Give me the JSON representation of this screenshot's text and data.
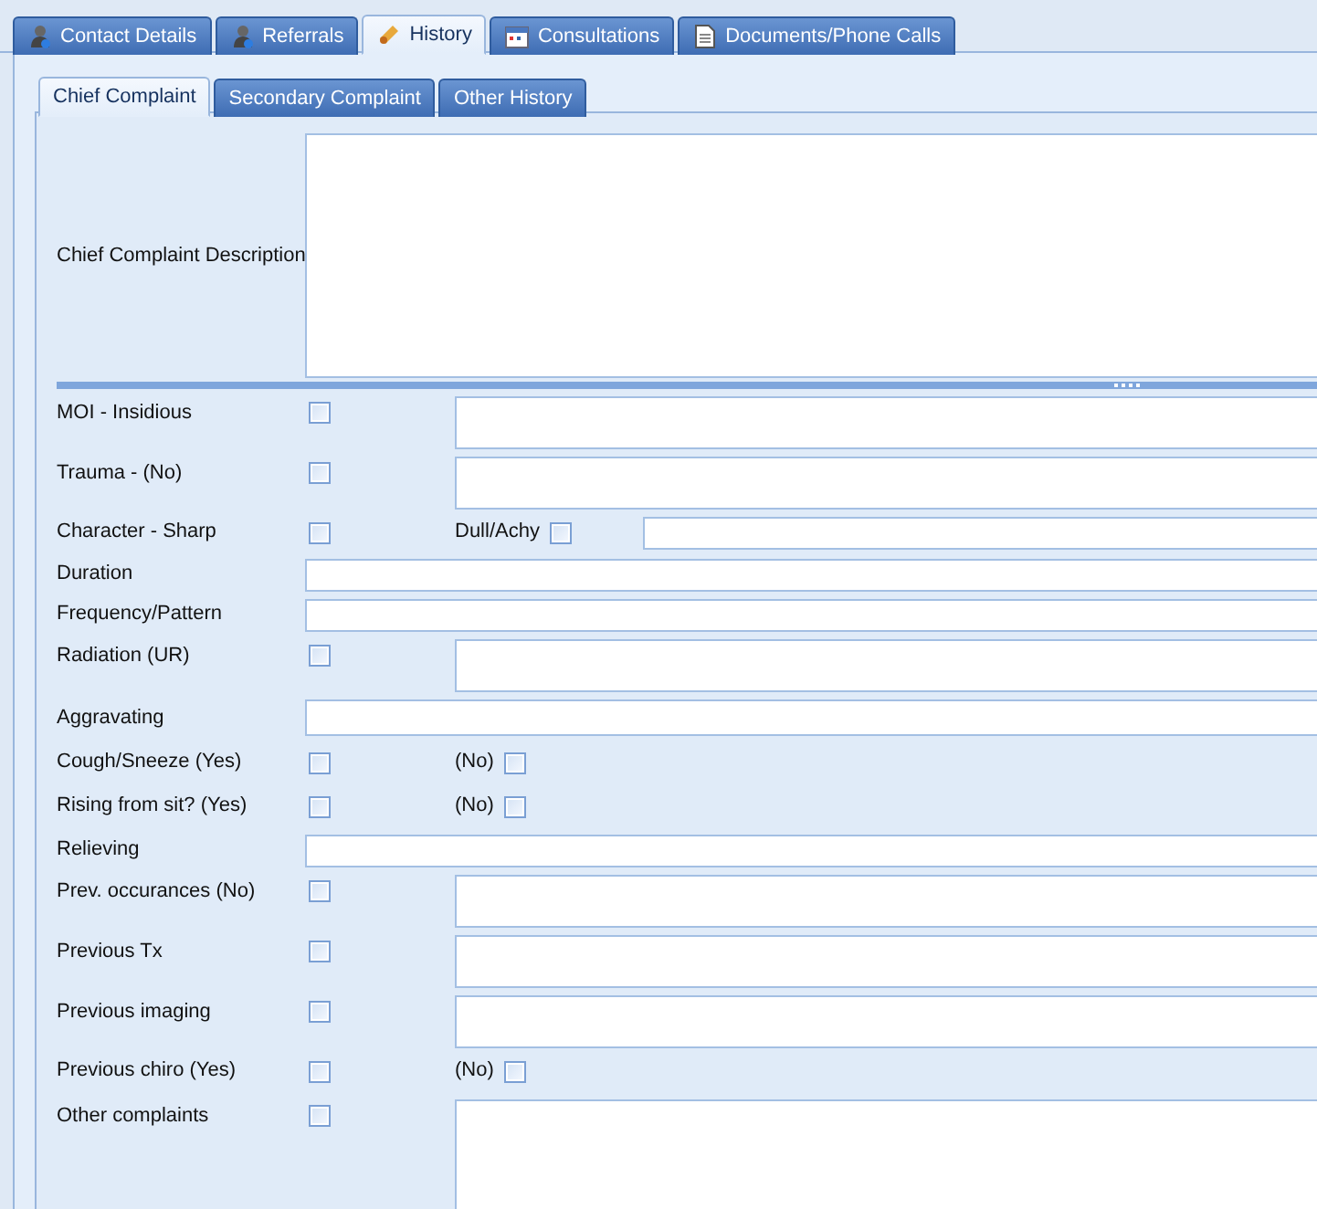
{
  "main_tabs": [
    {
      "label": "Contact Details",
      "selected": false
    },
    {
      "label": "Referrals",
      "selected": false
    },
    {
      "label": "History",
      "selected": true
    },
    {
      "label": "Consultations",
      "selected": false
    },
    {
      "label": "Documents/Phone Calls",
      "selected": false
    }
  ],
  "sub_tabs": [
    {
      "label": "Chief Complaint",
      "selected": true
    },
    {
      "label": "Secondary Complaint",
      "selected": false
    },
    {
      "label": "Other History",
      "selected": false
    }
  ],
  "description": {
    "label": "Chief Complaint Description"
  },
  "rows": [
    {
      "kind": "check_memo",
      "label": "MOI - Insidious",
      "checked": false
    },
    {
      "kind": "check_memo",
      "label": "Trauma - (No)",
      "checked": false
    },
    {
      "kind": "check_pair_field",
      "label": "Character - Sharp",
      "checked": false,
      "second_label": "Dull/Achy",
      "second_checked": false
    },
    {
      "kind": "text",
      "label": "Duration"
    },
    {
      "kind": "text",
      "label": "Frequency/Pattern"
    },
    {
      "kind": "check_memo",
      "label": "Radiation (UR)",
      "checked": false
    },
    {
      "kind": "text_tall",
      "label": "Aggravating"
    },
    {
      "kind": "check_pair",
      "label": "Cough/Sneeze (Yes)",
      "checked": false,
      "second_label": "(No)",
      "second_checked": false
    },
    {
      "kind": "check_pair",
      "label": "Rising from sit? (Yes)",
      "checked": false,
      "second_label": "(No)",
      "second_checked": false
    },
    {
      "kind": "text",
      "label": "Relieving"
    },
    {
      "kind": "check_memo",
      "label": "Prev. occurances (No)",
      "checked": false
    },
    {
      "kind": "check_memo",
      "label": "Previous Tx",
      "checked": false
    },
    {
      "kind": "check_memo",
      "label": "Previous imaging",
      "checked": false
    },
    {
      "kind": "check_pair",
      "label": "Previous chiro (Yes)",
      "checked": false,
      "second_label": "(No)",
      "second_checked": false
    },
    {
      "kind": "check_big",
      "label": "Other complaints",
      "checked": false
    }
  ]
}
